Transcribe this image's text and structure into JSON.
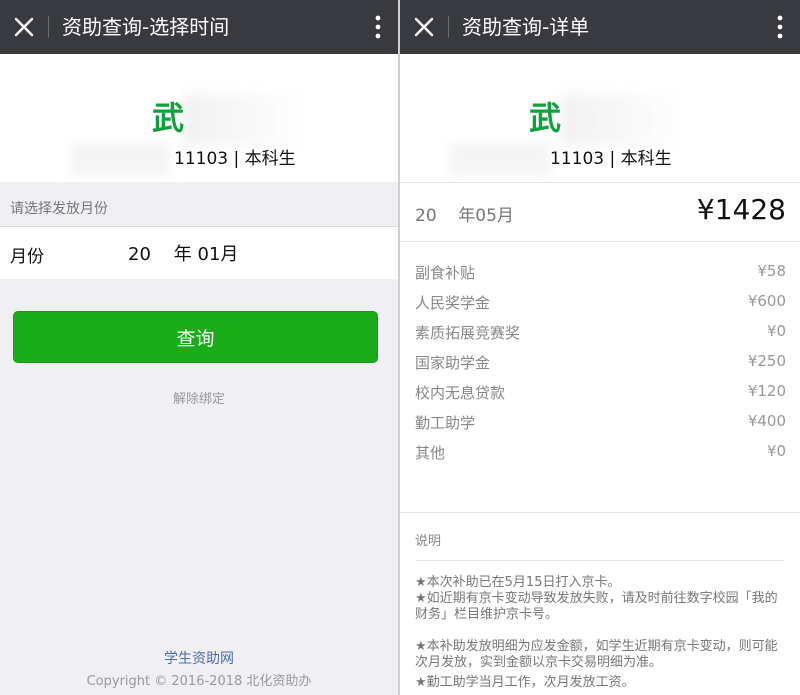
{
  "left": {
    "title": "资助查询-选择时间",
    "student": {
      "surname": "武",
      "id_suffix": "11103",
      "separator": "|",
      "degree": "本科生"
    },
    "prompt": "请选择发放月份",
    "month_label": "月份",
    "month_value": "20    年 01月",
    "query_button": "查询",
    "unbind_link": "解除绑定",
    "footer_link": "学生资助网",
    "copyright": "Copyright © 2016-2018 北化资助办"
  },
  "right": {
    "title": "资助查询-详单",
    "student": {
      "surname": "武",
      "id_suffix": "11103",
      "separator": "|",
      "degree": "本科生"
    },
    "summary_month": "20    年05月",
    "summary_total": "¥1428",
    "items": [
      {
        "label": "副食补贴",
        "amount": "¥58"
      },
      {
        "label": "人民奖学金",
        "amount": "¥600"
      },
      {
        "label": "素质拓展竞赛奖",
        "amount": "¥0"
      },
      {
        "label": "国家助学金",
        "amount": "¥250"
      },
      {
        "label": "校内无息贷款",
        "amount": "¥120"
      },
      {
        "label": "勤工助学",
        "amount": "¥400"
      },
      {
        "label": "其他",
        "amount": "¥0"
      }
    ],
    "notes_title": "说明",
    "notes": [
      "★本次补助已在5月15日打入京卡。",
      "★如近期有京卡变动导致发放失败，请及时前往数字校园「我的财务」栏目维护京卡号。",
      "★本补助发放明细为应发金额，如学生近期有京卡变动，则可能次月发放，实到金额以京卡交易明细为准。",
      "★勤工助学当月工作，次月发放工资。"
    ]
  },
  "icons": {
    "close": "close-icon",
    "more": "more-vertical-icon"
  },
  "colors": {
    "topbar": "#393a3f",
    "accent_green": "#1aad19",
    "name_green": "#0ea23a",
    "link_blue": "#4a6ea9",
    "page_bg": "#efeff4"
  }
}
